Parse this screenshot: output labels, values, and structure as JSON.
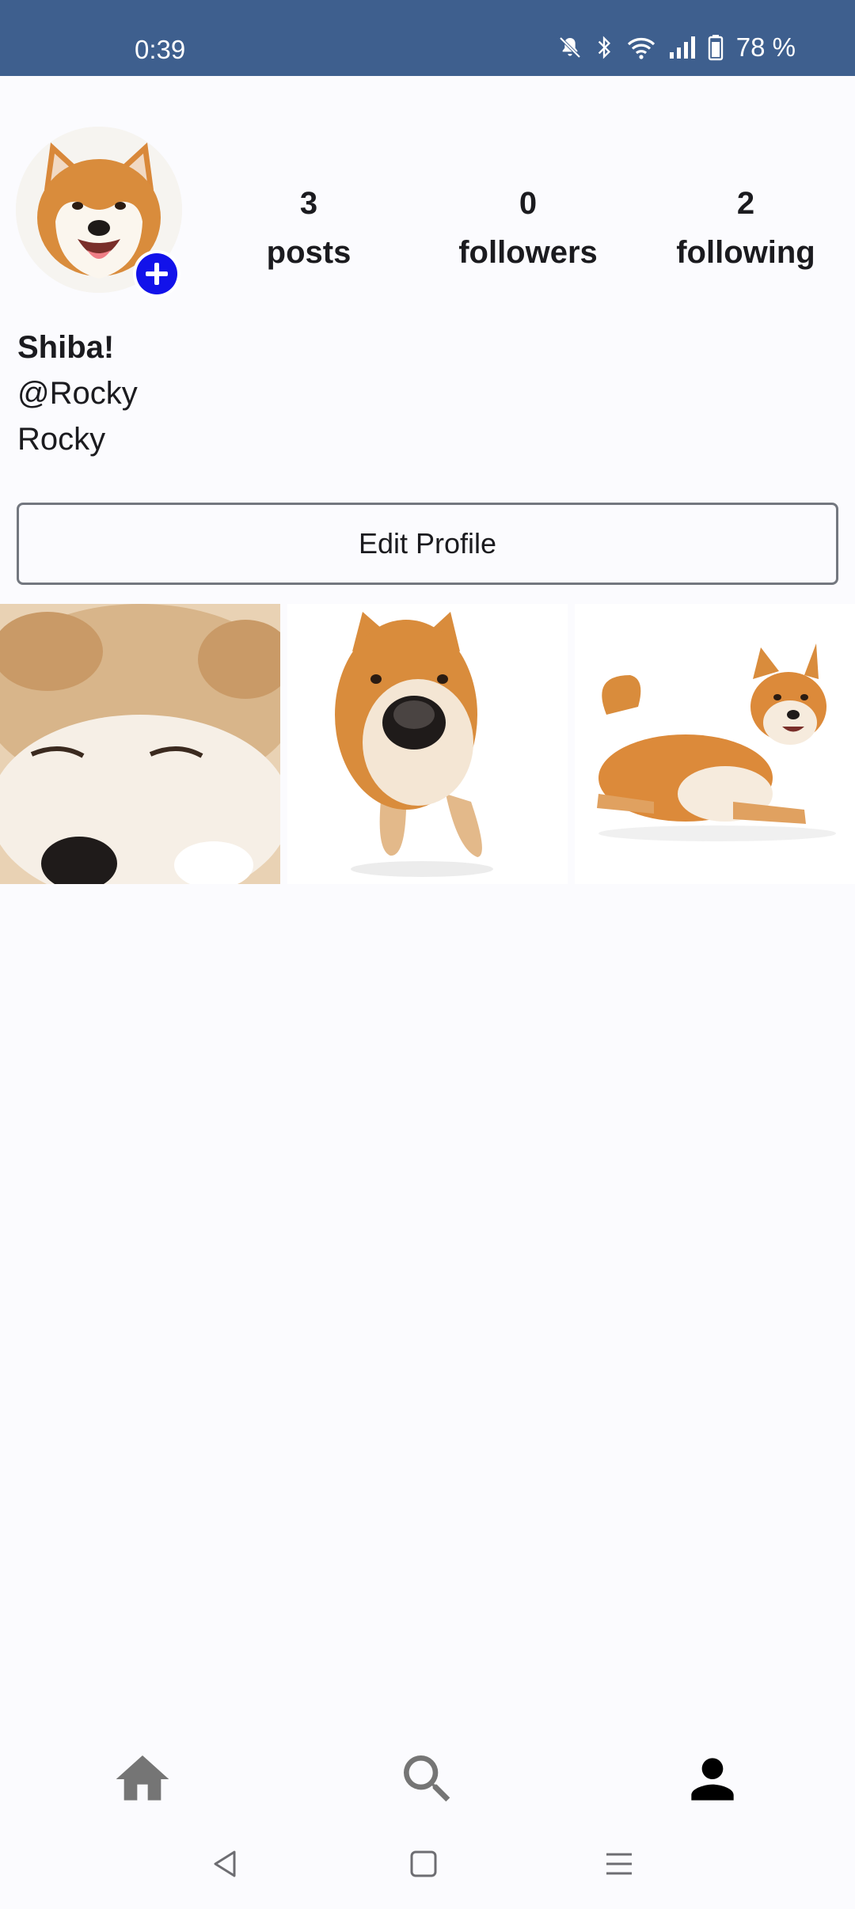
{
  "status_bar": {
    "time": "0:39",
    "battery": "78 %",
    "icons": [
      "mute-icon",
      "bluetooth-icon",
      "wifi-icon",
      "signal-icon",
      "battery-icon"
    ],
    "color": "#3e5f8e"
  },
  "profile": {
    "avatar_icon": "shiba-avatar",
    "add_badge_color": "#1212ea",
    "stats": {
      "posts_count": "3",
      "posts_label": "posts",
      "followers_count": "0",
      "followers_label": "followers",
      "following_count": "2",
      "following_label": "following"
    },
    "display_name": "Shiba!",
    "handle": "@Rocky",
    "bio": "Rocky",
    "edit_button_label": "Edit Profile"
  },
  "posts": [
    {
      "icon": "shiba-closeup-photo"
    },
    {
      "icon": "shiba-standing-photo"
    },
    {
      "icon": "shiba-lying-photo"
    }
  ],
  "bottom_nav": {
    "items": [
      {
        "icon": "home-icon",
        "active": false
      },
      {
        "icon": "search-icon",
        "active": false
      },
      {
        "icon": "person-icon",
        "active": true
      }
    ]
  },
  "system_nav": {
    "icons": [
      "back-icon",
      "home-square-icon",
      "recents-icon"
    ]
  }
}
